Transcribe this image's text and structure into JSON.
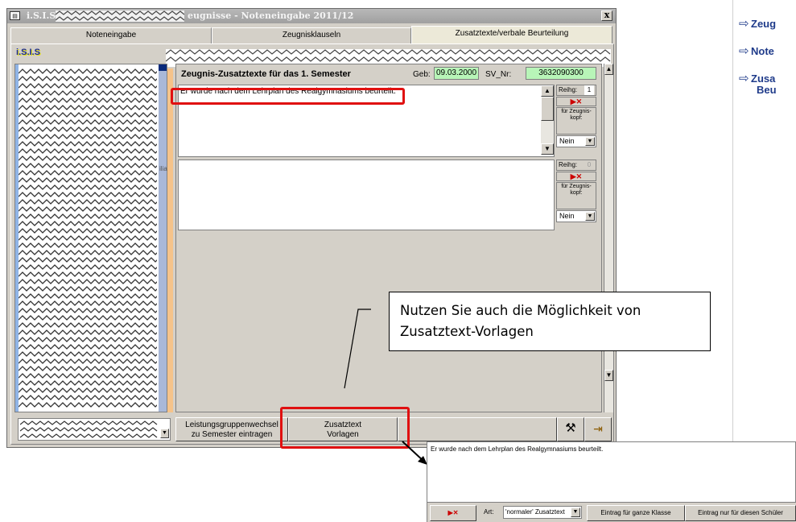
{
  "window": {
    "app_prefix": "i.S.I.S H",
    "title": "eugnisse - Noteneingabe 2011/12",
    "close_label": "x"
  },
  "tabs": [
    {
      "label": "Noteneingabe",
      "active": false
    },
    {
      "label": "Zeugnisklauseln",
      "active": false
    },
    {
      "label": "Zusatztexte/verbale Beurteilung",
      "active": true
    }
  ],
  "logo": "i.S.I.S",
  "student_list": {
    "trailing_text": "ilia"
  },
  "panel": {
    "title": "Zeugnis-Zusatztexte für das 1. Semester",
    "geb_label": "Geb:",
    "geb_value": "09.03.2000",
    "sv_label": "SV_Nr:",
    "sv_value": "3632090300"
  },
  "entries": [
    {
      "text": "Er wurde nach dem Lehrplan des Realgymnasiums beurteilt.",
      "reihg_label": "Reihg:",
      "reihg_value": "1",
      "fuer_label": "für Zeugnis-kopf:",
      "kopf_value": "Nein"
    },
    {
      "text": "",
      "reihg_label": "Reihg:",
      "reihg_value": "0",
      "fuer_label": "für Zeugnis-kopf:",
      "kopf_value": "Nein"
    }
  ],
  "toolbar": {
    "leistung_line1": "Leistungsgruppenwechsel",
    "leistung_line2": "zu Semester eintragen",
    "vorlagen_line1": "Zusatztext",
    "vorlagen_line2": "Vorlagen"
  },
  "callout": {
    "line1": "Nutzen Sie auch die Möglichkeit von",
    "line2": "Zusatztext-Vorlagen"
  },
  "popup": {
    "text": "Er wurde nach dem Lehrplan des Realgymnasiums beurteilt.",
    "art_label": "Art:",
    "art_value": "'normaler' Zusatztext",
    "btn_klasse": "Eintrag für ganze Klasse",
    "btn_schueler": "Eintrag nur für diesen Schüler"
  },
  "outline": {
    "items": [
      "Zeug",
      "Note",
      "Zusa"
    ],
    "sub": "Beu"
  },
  "colors": {
    "highlight": "#e01010",
    "field_green": "#b8f5b8",
    "outline_blue": "#1f3b8a",
    "logo_blue": "#1a2a9c"
  }
}
